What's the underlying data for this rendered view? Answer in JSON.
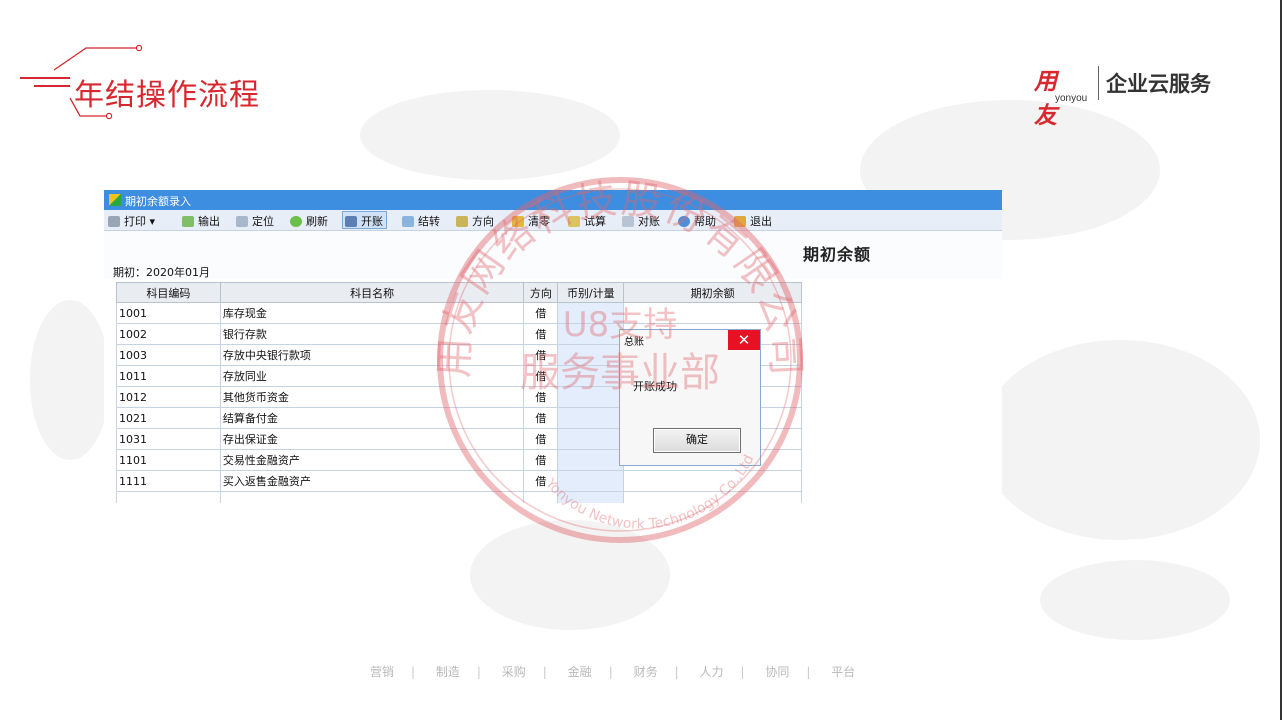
{
  "slide": {
    "title": "二、年结操作流程",
    "title_visible": "年结操作流程",
    "logo_main": "用友",
    "logo_sub": "yonyou",
    "logo_tagline": "企业云服务",
    "accent_color": "#d7282f"
  },
  "window": {
    "title": "期初余额录入",
    "toolbar": [
      {
        "label": "打印",
        "icon": "printer-icon",
        "has_dropdown": true
      },
      {
        "label": "输出",
        "icon": "export-icon"
      },
      {
        "label": "定位",
        "icon": "locate-icon"
      },
      {
        "label": "刷新",
        "icon": "refresh-icon"
      },
      {
        "label": "开账",
        "icon": "open-book-icon",
        "active": true
      },
      {
        "label": "结转",
        "icon": "carry-forward-icon"
      },
      {
        "label": "方向",
        "icon": "direction-icon"
      },
      {
        "label": "清零",
        "icon": "clear-icon"
      },
      {
        "label": "试算",
        "icon": "trial-balance-icon"
      },
      {
        "label": "对账",
        "icon": "reconcile-icon"
      },
      {
        "label": "帮助",
        "icon": "help-icon"
      },
      {
        "label": "退出",
        "icon": "exit-icon"
      }
    ],
    "heading": "期初余额",
    "period": "期初：2020年01月",
    "columns": [
      "科目编码",
      "科目名称",
      "方向",
      "币别/计量",
      "期初余额"
    ],
    "rows": [
      {
        "code": "1001",
        "name": "库存现金",
        "dir": "借"
      },
      {
        "code": "1002",
        "name": "银行存款",
        "dir": "借"
      },
      {
        "code": "1003",
        "name": "存放中央银行款项",
        "dir": "借"
      },
      {
        "code": "1011",
        "name": "存放同业",
        "dir": "借"
      },
      {
        "code": "1012",
        "name": "其他货币资金",
        "dir": "借"
      },
      {
        "code": "1021",
        "name": "结算备付金",
        "dir": "借"
      },
      {
        "code": "1031",
        "name": "存出保证金",
        "dir": "借"
      },
      {
        "code": "1101",
        "name": "交易性金融资产",
        "dir": "借"
      },
      {
        "code": "1111",
        "name": "买入返售金融资产",
        "dir": "借"
      }
    ]
  },
  "dialog": {
    "title": "总账",
    "close_glyph": "✕",
    "message": "开账成功",
    "ok_label": "确定"
  },
  "stamp": {
    "top_arc": "用友网络科技股份有限公司",
    "middle_line1": "U8支持",
    "middle_line2": "服务事业部",
    "bottom_arc": "Yonyou Network Technology Co.,Ltd",
    "color": "#e0676d"
  },
  "footer": {
    "items": [
      "营销",
      "制造",
      "采购",
      "金融",
      "财务",
      "人力",
      "协同",
      "平台"
    ],
    "separator": "|"
  }
}
